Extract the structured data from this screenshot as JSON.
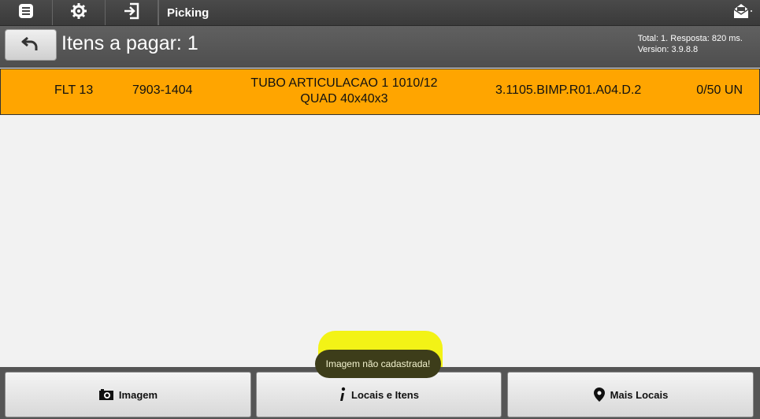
{
  "toolbar": {
    "title": "Picking",
    "icons": [
      "list-icon",
      "gear-icon",
      "login-icon",
      "mail-icon"
    ]
  },
  "header": {
    "title": "Itens a pagar: 1",
    "stats_line1": "Total: 1. Resposta: 820 ms.",
    "stats_line2": "Version: 3.9.8.8"
  },
  "item": {
    "flt": "FLT 13",
    "code": "7903-1404",
    "description": "TUBO ARTICULACAO 1 1010/12 QUAD 40x40x3",
    "location": "3.1105.BIMP.R01.A04.D.2",
    "quantity": "0/50 UN"
  },
  "toast": {
    "message": "Imagem não cadastrada!"
  },
  "bottom": {
    "image_label": "Imagem",
    "locals_label": "Locais e Itens",
    "more_locals_label": "Mais Locais"
  },
  "colors": {
    "row_highlight": "#ffa500",
    "toolbar": "#3f3f3f",
    "marker": "#f2f20a"
  }
}
